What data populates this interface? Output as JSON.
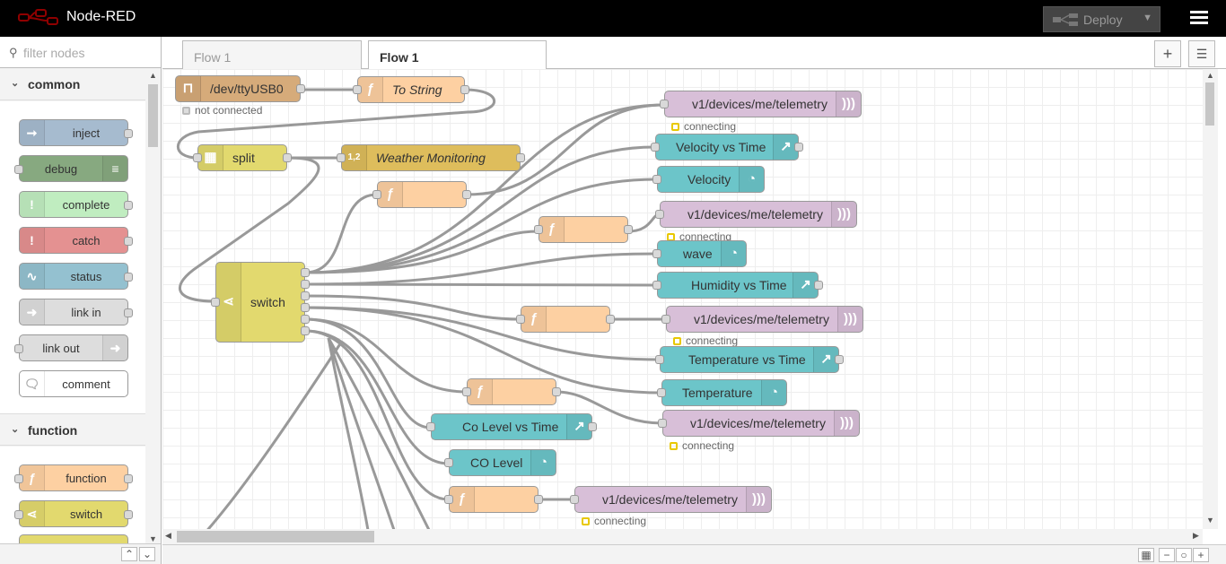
{
  "header": {
    "app_name": "Node-RED",
    "deploy_label": "Deploy"
  },
  "palette": {
    "filter_placeholder": "filter nodes",
    "categories": [
      {
        "name": "common",
        "nodes": [
          "inject",
          "debug",
          "complete",
          "catch",
          "status",
          "link in",
          "link out",
          "comment"
        ]
      },
      {
        "name": "function",
        "nodes": [
          "function",
          "switch"
        ]
      }
    ]
  },
  "tabs": [
    {
      "label": "Flow 1"
    },
    {
      "label": "Flow 1"
    }
  ],
  "flow": {
    "serial": {
      "label": "/dev/ttyUSB0",
      "status": "not connected"
    },
    "to_string": {
      "label": "To String"
    },
    "split": {
      "label": "split"
    },
    "template": {
      "label": "Weather Monitoring"
    },
    "switch": {
      "label": "switch"
    },
    "mqtt_status": "connecting",
    "outputs": {
      "mqtt1": "v1/devices/me/telemetry",
      "velocity_chart": "Velocity vs Time",
      "velocity_gauge": "Velocity",
      "mqtt2": "v1/devices/me/telemetry",
      "wave_gauge": "wave",
      "humidity_chart": "Humidity vs Time",
      "mqtt3": "v1/devices/me/telemetry",
      "temperature_chart": "Temperature vs Time",
      "temperature_gauge": "Temperature",
      "mqtt4": "v1/devices/me/telemetry",
      "co_chart": "Co Level vs Time",
      "co_gauge": "CO Level",
      "mqtt5": "v1/devices/me/telemetry"
    }
  }
}
